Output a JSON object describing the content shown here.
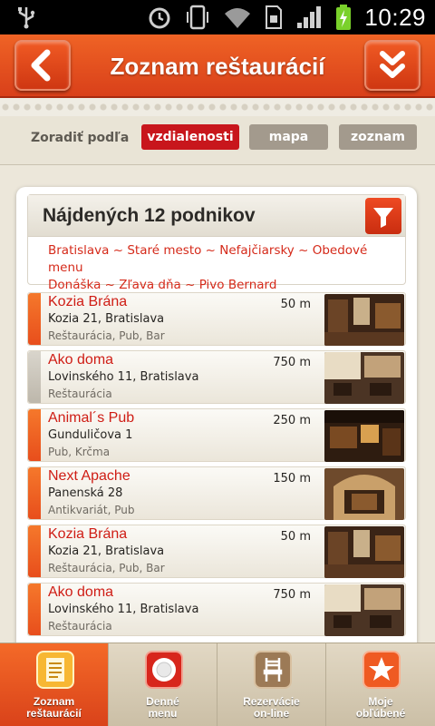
{
  "status_bar": {
    "time": "10:29"
  },
  "header": {
    "title": "Zoznam reštaurácií"
  },
  "sort": {
    "label": "Zoradiť podľa",
    "options": [
      "vzdialenosti",
      "mapa",
      "zoznam"
    ],
    "active": "vzdialenosti"
  },
  "results": {
    "title": "Nájdených 12 podnikov",
    "filters_line1": "Bratislava ~ Staré mesto ~ Nefajčiarsky ~ Obedové menu",
    "filters_line2": "Donáška ~ Zľava dňa ~ Pivo Bernard"
  },
  "items": [
    {
      "name": "Kozia Brána",
      "address": "Kozia 21, Bratislava",
      "category": "Reštaurácia, Pub, Bar",
      "distance": "50 m",
      "highlight": true
    },
    {
      "name": "Ako doma",
      "address": "Lovinského 11, Bratislava",
      "category": "Reštaurácia",
      "distance": "750 m",
      "highlight": false
    },
    {
      "name": "Animal´s Pub",
      "address": "Gunduličova 1",
      "category": "Pub, Krčma",
      "distance": "250 m",
      "highlight": true
    },
    {
      "name": "Next Apache",
      "address": "Panenská 28",
      "category": "Antikvariát, Pub",
      "distance": "150 m",
      "highlight": true
    },
    {
      "name": "Kozia Brána",
      "address": "Kozia 21, Bratislava",
      "category": "Reštaurácia, Pub, Bar",
      "distance": "50 m",
      "highlight": true
    },
    {
      "name": "Ako doma",
      "address": "Lovinského 11, Bratislava",
      "category": "Reštaurácia",
      "distance": "750 m",
      "highlight": true
    }
  ],
  "bottom_nav": [
    {
      "label": "Zoznam\nreštaurácií",
      "icon": "list-icon",
      "active": true
    },
    {
      "label": "Denné\nmenu",
      "icon": "plate-icon",
      "active": false
    },
    {
      "label": "Rezervácie\non-line",
      "icon": "chair-icon",
      "active": false
    },
    {
      "label": "Moje\nobľúbené",
      "icon": "star-icon",
      "active": false
    }
  ],
  "colors": {
    "accent": "#e8481c",
    "red_text": "#cf1d15",
    "sort_active": "#c8161c"
  }
}
